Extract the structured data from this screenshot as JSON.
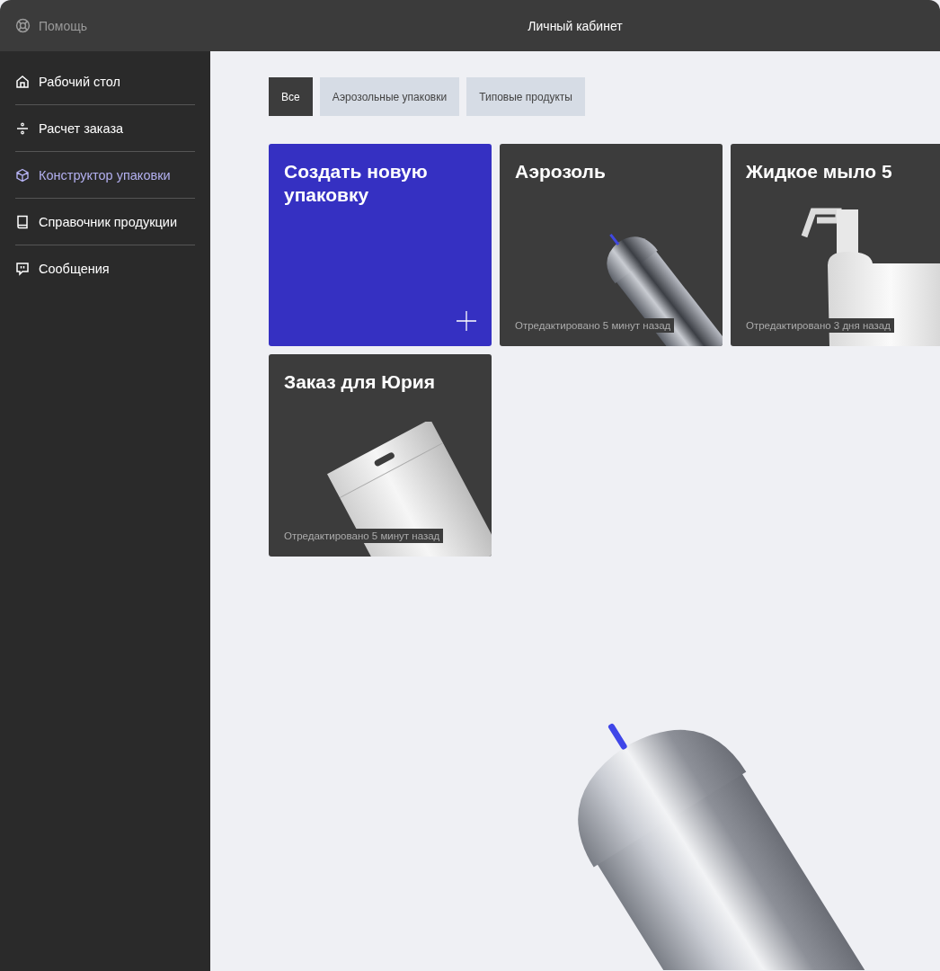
{
  "topbar": {
    "help": "Помощь",
    "title": "Личный кабинет"
  },
  "sidebar": {
    "items": [
      {
        "label": "Рабочий стол",
        "selected": false
      },
      {
        "label": "Расчет заказа",
        "selected": false
      },
      {
        "label": "Конструктор упаковки",
        "selected": true
      },
      {
        "label": "Справочник продукции",
        "selected": false
      },
      {
        "label": "Сообщения",
        "selected": false
      }
    ]
  },
  "tabs": [
    {
      "label": "Все",
      "selected": true
    },
    {
      "label": "Аэрозольные упаковки",
      "selected": false
    },
    {
      "label": "Типовые продукты",
      "selected": false
    }
  ],
  "cards": [
    {
      "kind": "create",
      "title": "Создать новую упаковку"
    },
    {
      "kind": "aerosol",
      "title": "Аэрозоль",
      "edited": "Отредактировано 5 минут назад"
    },
    {
      "kind": "bottle",
      "title": "Жидкое мыло 5",
      "edited": "Отредактировано 3 дня назад"
    },
    {
      "kind": "pouch",
      "title": "Заказ для Юрия",
      "edited": "Отредактировано 5 минут назад"
    }
  ]
}
